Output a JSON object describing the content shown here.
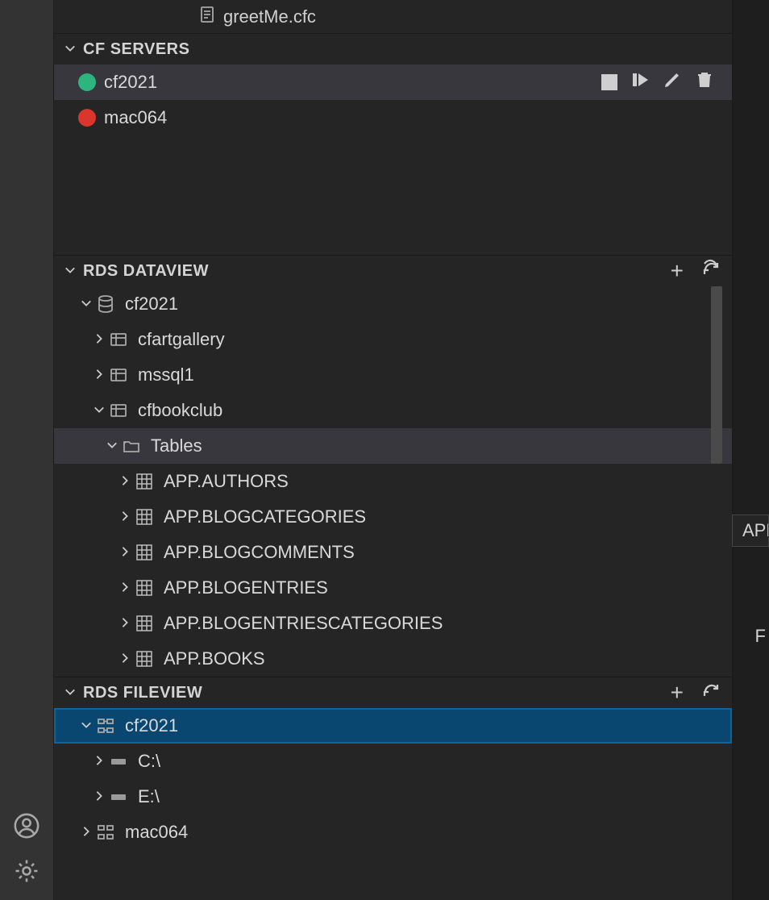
{
  "topFile": {
    "name": "greetMe.cfc"
  },
  "sections": {
    "cfservers": {
      "title": "CF SERVERS",
      "items": [
        {
          "label": "cf2021",
          "statusColor": "#2cb67d",
          "selected": true
        },
        {
          "label": "mac064",
          "statusColor": "#d9362e",
          "selected": false
        }
      ]
    },
    "rdsdataview": {
      "title": "RDS DATAVIEW",
      "root": {
        "label": "cf2021"
      },
      "datasources": [
        {
          "label": "cfartgallery",
          "expanded": false
        },
        {
          "label": "mssql1",
          "expanded": false
        },
        {
          "label": "cfbookclub",
          "expanded": true
        }
      ],
      "tablesFolderLabel": "Tables",
      "tables": [
        "APP.AUTHORS",
        "APP.BLOGCATEGORIES",
        "APP.BLOGCOMMENTS",
        "APP.BLOGENTRIES",
        "APP.BLOGENTRIESCATEGORIES",
        "APP.BOOKS"
      ]
    },
    "rdsfileview": {
      "title": "RDS FILEVIEW",
      "servers": [
        {
          "label": "cf2021",
          "expanded": true,
          "selected": true,
          "drives": [
            "C:\\",
            "E:\\"
          ]
        },
        {
          "label": "mac064",
          "expanded": false,
          "selected": false,
          "drives": []
        }
      ]
    }
  },
  "tooltipPartial": "APP",
  "strayLetter": "F"
}
